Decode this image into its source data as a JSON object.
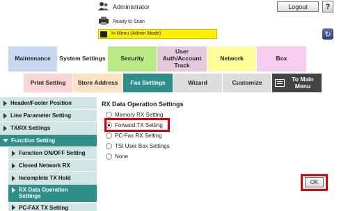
{
  "header": {
    "user_label": "Administrator",
    "logout_label": "Logout",
    "help_label": "?",
    "status_text": "Ready to Scan",
    "mode_text": "In Menu (Admin Mode)"
  },
  "tabs_row1": [
    {
      "label": "Maintenance",
      "color": "#c9d7f2"
    },
    {
      "label": "System Settings",
      "color": "#ffffff"
    },
    {
      "label": "Security",
      "color": "#b9ec85"
    },
    {
      "label": "User Auth/Account Track",
      "color": "#e7c9de"
    },
    {
      "label": "Network",
      "color": "#fdfd9a"
    },
    {
      "label": "Box",
      "color": "#f6cdf0"
    }
  ],
  "tabs_row2": [
    {
      "label": "Print Setting",
      "color": "#fbd6d6"
    },
    {
      "label": "Store Address",
      "color": "#fde2c4"
    },
    {
      "label": "Fax Settings",
      "color": "#2e8f8a"
    },
    {
      "label": "Wizard",
      "color": "#dcdcdc"
    },
    {
      "label": "Customize",
      "color": "#dcdcdc"
    },
    {
      "label": "To Main Menu",
      "color": "#444444"
    }
  ],
  "sidebar": {
    "items": [
      {
        "label": "Header/Footer Position"
      },
      {
        "label": "Line Parameter Setting"
      },
      {
        "label": "TX/RX Settings"
      },
      {
        "label": "Function Setting"
      },
      {
        "label": "Function ON/OFF Setting"
      },
      {
        "label": "Closed Network RX"
      },
      {
        "label": "Incomplete TX Hold"
      },
      {
        "label": "RX Data Operation Settings"
      },
      {
        "label": "PC-FAX TX Setting"
      }
    ]
  },
  "content": {
    "title": "RX Data Operation Settings",
    "options": [
      {
        "label": "Memory RX Setting",
        "selected": false
      },
      {
        "label": "Forward TX Setting",
        "selected": true
      },
      {
        "label": "PC-Fax RX Setting",
        "selected": false
      },
      {
        "label": "TSI User Box Settings",
        "selected": false
      },
      {
        "label": "None",
        "selected": false
      }
    ],
    "ok_label": "OK"
  }
}
